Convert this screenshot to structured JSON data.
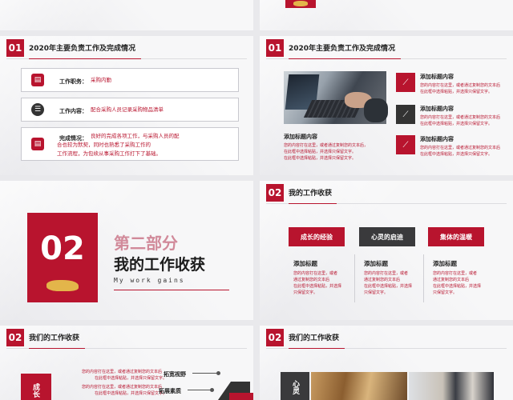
{
  "section1": {
    "number": "01",
    "title": "2020年主要负责工作及完成情况",
    "items": [
      {
        "label": "工作职务：",
        "text": "采购内勤"
      },
      {
        "label": "工作内容：",
        "text": "配合采购人员记录采购物品清单"
      },
      {
        "label": "完成情况：",
        "lines": [
          "良好的完成各项工作，与采购人员的配",
          "合也较为默契，同时也熟悉了采购工作的",
          "工作流程，为包续从事采购工作打下了基础。"
        ]
      }
    ]
  },
  "section1b": {
    "number": "01",
    "title": "2020年主要负责工作及完成情况",
    "caption_title": "添加标题内容",
    "caption_lines": [
      "您的内容打在这里，或者通过复制您的文本后，",
      "在此框中选择粘贴，并选择只保留文字。",
      "在此框中选择粘贴，并选择只保留文字。"
    ],
    "features": [
      {
        "title": "添加标题内容",
        "lines": [
          "您的内容打在这里，或者通过复制您的文本后",
          "在此框中选择粘贴，并选择只保留文字。"
        ],
        "icon": "chart-line-icon"
      },
      {
        "title": "添加标题内容",
        "lines": [
          "您的内容打在这里，或者通过复制您的文本后",
          "在此框中选择粘贴，并选择只保留文字。"
        ],
        "icon": "chart-line-icon"
      },
      {
        "title": "添加标题内容",
        "lines": [
          "您的内容打在这里，或者通过复制您的文本后",
          "在此框中选择粘贴，并选择只保留文字。"
        ],
        "icon": "chart-line-icon"
      }
    ]
  },
  "part2": {
    "number": "02",
    "heading_red": "第二部分",
    "heading": "我的工作收获",
    "subtitle": "My work gains"
  },
  "gains": {
    "number": "02",
    "title": "我的工作收获",
    "columns": [
      {
        "head": "成长的经验",
        "title": "添加标题",
        "lines": [
          "您的内容打在这里，或者",
          "通过复制您的文本后",
          "在此框中选择粘贴，并选择",
          "只保留文字。"
        ]
      },
      {
        "head": "心灵的启迪",
        "title": "添加标题",
        "lines": [
          "您的内容打在这里，或者",
          "通过复制您的文本后",
          "在此框中选择粘贴，并选择",
          "只保留文字。"
        ]
      },
      {
        "head": "集体的温暖",
        "title": "添加标题",
        "lines": [
          "您的内容打在这里，或者",
          "通过复制您的文本后",
          "在此框中选择粘贴，并选择",
          "只保留文字。"
        ]
      }
    ]
  },
  "gains2": {
    "number": "02",
    "title": "我们的工作收获",
    "labels": [
      "拓宽视野",
      "拓展素质"
    ],
    "texts": [
      [
        "您的内容打在这里，或者通过复制您的文本后",
        "在此框中选择粘贴，并选择只保留文字。"
      ],
      [
        "您的内容打在这里，或者通过复制您的文本后",
        "在此框中选择粘贴，并选择只保留文字。"
      ]
    ],
    "side_label": "成长"
  },
  "gains3": {
    "number": "02",
    "title": "我们的工作收获",
    "side_label": "心灵"
  },
  "colors": {
    "accent": "#b8142e",
    "dark": "#333333"
  }
}
